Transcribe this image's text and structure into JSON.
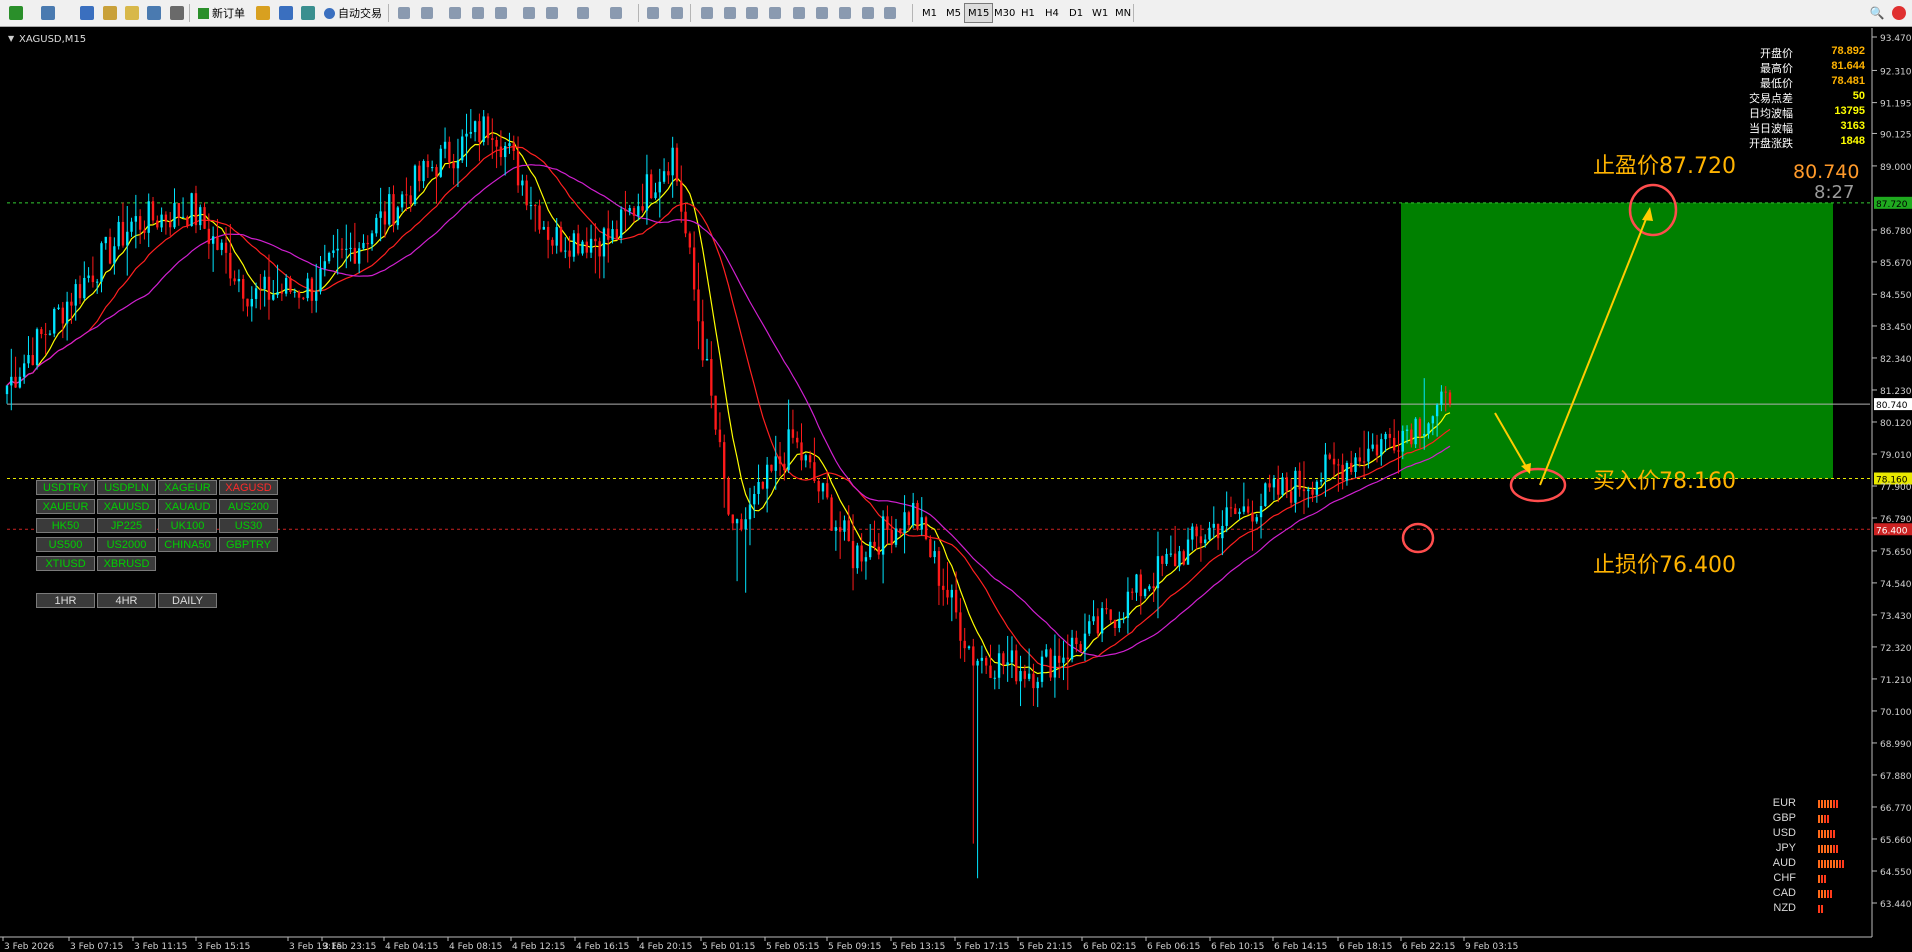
{
  "toolbar": {
    "new_order_label": "新订单",
    "autotrade_label": "自动交易",
    "timeframes": [
      "M1",
      "M5",
      "M15",
      "M30",
      "H1",
      "H4",
      "D1",
      "W1",
      "MN"
    ],
    "active_timeframe": "M15"
  },
  "chart": {
    "symbol_title": "XAGUSD,M15",
    "current_price_label": "80.740",
    "countdown": "8:27",
    "take_profit_text": "止盈价87.720",
    "entry_text": "买入价78.160",
    "stop_loss_text": "止损价76.400",
    "tp_line_label": "87.720",
    "entry_line_label": "78.160",
    "sl_line_label": "76.400",
    "bid_line_label": "80.740",
    "colors": {
      "background": "#000000",
      "bull_candle": "#00e5ff",
      "bear_candle": "#ff1a1a",
      "ma_fast": "#ffff00",
      "ma_mid": "#ff2020",
      "ma_slow": "#d020d0",
      "profit_zone": "#008000",
      "annotation": "#ffb300",
      "circle": "#ff4d4d",
      "arrow": "#ffcc00"
    }
  },
  "info_panel": [
    {
      "label": "开盘价",
      "value": "78.892",
      "color": "#ffb300"
    },
    {
      "label": "最高价",
      "value": "81.644",
      "color": "#ffb300"
    },
    {
      "label": "最低价",
      "value": "78.481",
      "color": "#ffb300"
    },
    {
      "label": "交易点差",
      "value": "50",
      "color": "#ffff00"
    },
    {
      "label": "日均波幅",
      "value": "13795",
      "color": "#ffff00"
    },
    {
      "label": "当日波幅",
      "value": "3163",
      "color": "#ffff00"
    },
    {
      "label": "开盘涨跌",
      "value": "1848",
      "color": "#ffff00"
    }
  ],
  "symbol_buttons": [
    [
      "USDTRY",
      "USDPLN",
      "XAGEUR",
      "XAGUSD"
    ],
    [
      "XAUEUR",
      "XAUUSD",
      "XAUAUD",
      "AUS200"
    ],
    [
      "HK50",
      "JP225",
      "UK100",
      "US30"
    ],
    [
      "US500",
      "US2000",
      "CHINA50",
      "GBPTRY"
    ],
    [
      "XTIUSD",
      "XBRUSD"
    ]
  ],
  "current_symbol": "XAGUSD",
  "period_buttons": [
    "1HR",
    "4HR",
    "DAILY"
  ],
  "currency_strength": [
    {
      "name": "EUR",
      "bars": 7
    },
    {
      "name": "GBP",
      "bars": 4
    },
    {
      "name": "USD",
      "bars": 6
    },
    {
      "name": "JPY",
      "bars": 7
    },
    {
      "name": "AUD",
      "bars": 9
    },
    {
      "name": "CHF",
      "bars": 3
    },
    {
      "name": "CAD",
      "bars": 5
    },
    {
      "name": "NZD",
      "bars": 2
    }
  ],
  "price_axis": [
    "93.470",
    "92.310",
    "91.195",
    "90.125",
    "89.000",
    "87.720",
    "86.780",
    "85.670",
    "84.550",
    "83.450",
    "82.340",
    "81.230",
    "80.740",
    "80.120",
    "79.010",
    "78.160",
    "77.900",
    "76.790",
    "76.400",
    "75.650",
    "74.540",
    "73.430",
    "72.320",
    "71.210",
    "70.100",
    "68.990",
    "67.880",
    "66.770",
    "65.660",
    "64.550",
    "63.440"
  ],
  "time_axis": [
    "3 Feb 2026",
    "3 Feb 07:15",
    "3 Feb 11:15",
    "3 Feb 15:15",
    "3 Feb 19:15",
    "3 Feb 23:15",
    "4 Feb 04:15",
    "4 Feb 08:15",
    "4 Feb 12:15",
    "4 Feb 16:15",
    "4 Feb 20:15",
    "5 Feb 01:15",
    "5 Feb 05:15",
    "5 Feb 09:15",
    "5 Feb 13:15",
    "5 Feb 17:15",
    "5 Feb 21:15",
    "6 Feb 02:15",
    "6 Feb 06:15",
    "6 Feb 10:15",
    "6 Feb 14:15",
    "6 Feb 18:15",
    "6 Feb 22:15",
    "9 Feb 03:15"
  ],
  "chart_data": {
    "type": "candlestick",
    "symbol": "XAGUSD",
    "timeframe": "M15",
    "ylim": [
      63.44,
      93.47
    ],
    "key_points": [
      {
        "t": "3 Feb 2026",
        "close": 81.4
      },
      {
        "t": "3 Feb 07:15",
        "close": 84.5
      },
      {
        "t": "3 Feb 11:15",
        "close": 87.0
      },
      {
        "t": "3 Feb 15:15",
        "close": 87.5
      },
      {
        "t": "3 Feb 19:15",
        "close": 84.5
      },
      {
        "t": "3 Feb 23:15",
        "close": 84.8
      },
      {
        "t": "4 Feb 04:15",
        "close": 86.8
      },
      {
        "t": "4 Feb 08:15",
        "close": 89.0
      },
      {
        "t": "4 Feb 12:15",
        "close": 90.5
      },
      {
        "t": "4 Feb 16:15",
        "close": 86.5
      },
      {
        "t": "4 Feb 20:15",
        "close": 86.5
      },
      {
        "t": "5 Feb 01:15",
        "close": 89.5
      },
      {
        "t": "5 Feb 05:15",
        "close": 76.0
      },
      {
        "t": "5 Feb 09:15",
        "close": 79.5
      },
      {
        "t": "5 Feb 13:15",
        "close": 75.5
      },
      {
        "t": "5 Feb 17:15",
        "close": 77.0
      },
      {
        "t": "5 Feb 21:15",
        "close": 72.0
      },
      {
        "t": "6 Feb 02:15",
        "close": 71.5
      },
      {
        "t": "6 Feb 06:15",
        "close": 72.8
      },
      {
        "t": "6 Feb 10:15",
        "close": 74.8
      },
      {
        "t": "6 Feb 14:15",
        "close": 76.5
      },
      {
        "t": "6 Feb 18:15",
        "close": 77.6
      },
      {
        "t": "6 Feb 22:15",
        "close": 78.5
      },
      {
        "t": "9 Feb 03:15",
        "close": 80.74
      }
    ],
    "levels": {
      "take_profit": 87.72,
      "entry": 78.16,
      "stop_loss": 76.4,
      "bid": 80.74
    }
  }
}
